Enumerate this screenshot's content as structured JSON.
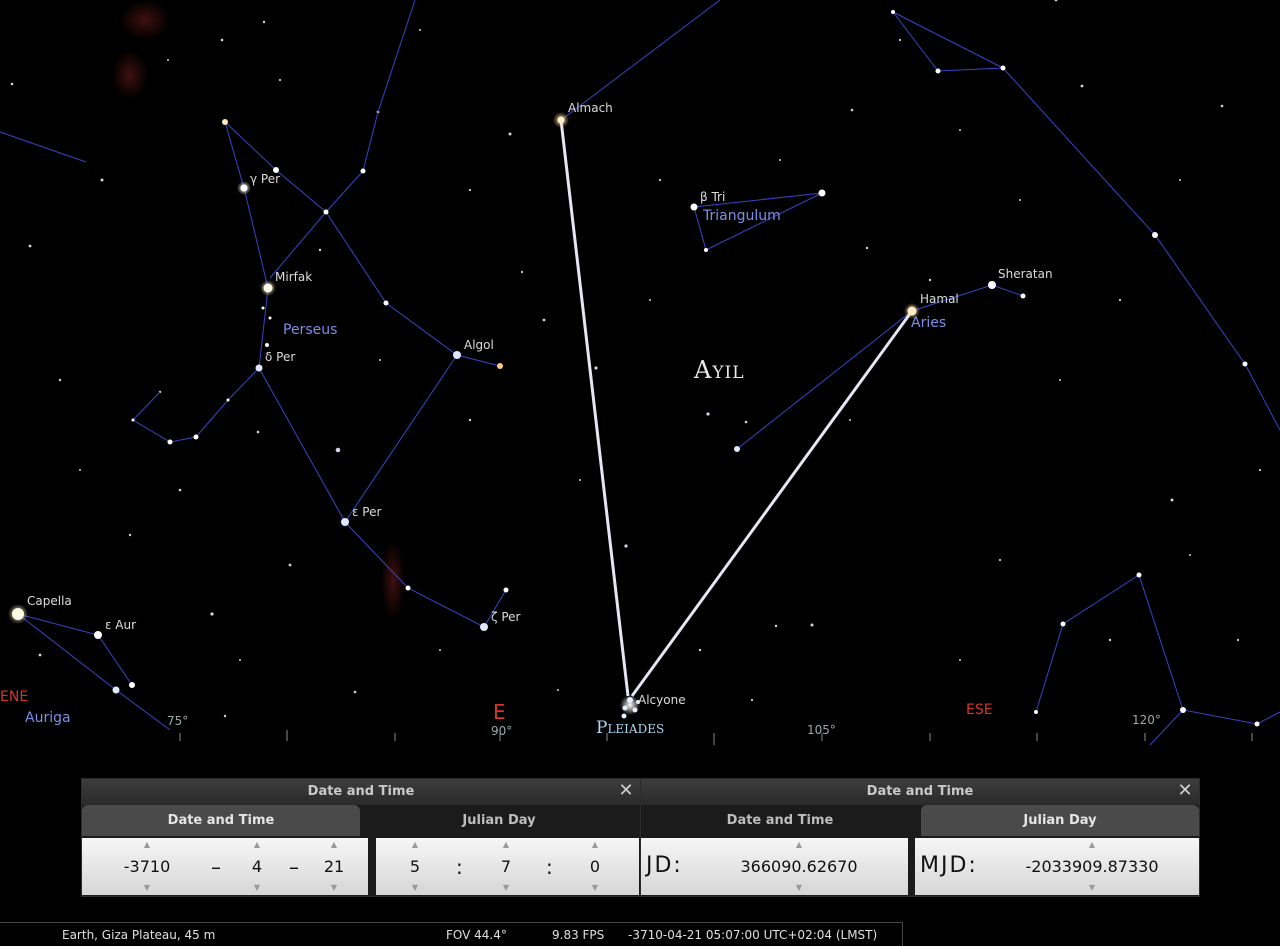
{
  "sky": {
    "star_labels": {
      "almach": "Almach",
      "beta_tri": "β Tri",
      "gamma_per": "γ Per",
      "mirfak": "Mirfak",
      "algol": "Algol",
      "delta_per": "δ Per",
      "epsilon_per": "ε Per",
      "zeta_per": "ζ Per",
      "capella": "Capella",
      "epsilon_aur": "ε Aur",
      "hamal": "Hamal",
      "sheratan": "Sheratan",
      "alcyone": "Alcyone"
    },
    "constellations": {
      "triangulum": "Triangulum",
      "perseus": "Perseus",
      "aries": "Aries",
      "auriga": "Auriga"
    },
    "asterism": "Ayil",
    "cluster": "Pleiades",
    "compass": {
      "ene": "ENE",
      "e": "E",
      "ese": "ESE"
    },
    "azimuth": {
      "a75": "75°",
      "a90": "90°",
      "a105": "105°",
      "a120": "120°"
    },
    "colors": {
      "constellation_line": "#3a44c8",
      "asterism_line": "#e6e6f2",
      "cardinal": "#d0382a"
    }
  },
  "dialog_left": {
    "title": "Date and Time",
    "tabs": {
      "date_time": "Date and Time",
      "julian_day": "Julian Day"
    },
    "active_tab": "Date and Time",
    "date": {
      "year": "-3710",
      "month": "4",
      "day": "21"
    },
    "time": {
      "hour": "5",
      "minute": "7",
      "second": "0"
    },
    "sep_dash": "–",
    "sep_colon": ":"
  },
  "dialog_right": {
    "title": "Date and Time",
    "tabs": {
      "date_time": "Date and Time",
      "julian_day": "Julian Day"
    },
    "active_tab": "Julian Day",
    "jd_label": "JD:",
    "jd_value": "366090.62670",
    "mjd_label": "MJD:",
    "mjd_value": "-2033909.87330"
  },
  "status": {
    "location": "Earth, Giza Plateau, 45 m",
    "fov": "FOV 44.4°",
    "fps": "9.83 FPS",
    "datetime": "-3710-04-21 05:07:00 UTC+02:04 (LMST)"
  }
}
